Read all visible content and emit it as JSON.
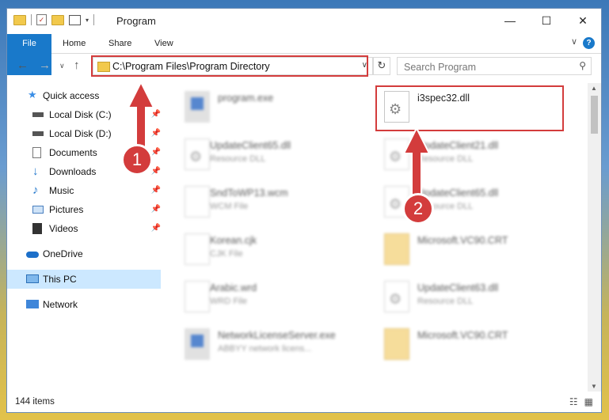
{
  "window": {
    "title": "Program",
    "controls": {
      "minimize": "—",
      "maximize": "☐",
      "close": "✕"
    }
  },
  "ribbon": {
    "tabs": [
      "File",
      "Home",
      "Share",
      "View"
    ],
    "help": "?",
    "collapse": "∨"
  },
  "nav": {
    "back": "←",
    "forward": "→",
    "recent": "∨",
    "up": "↑",
    "address": "C:\\Program Files\\Program Directory",
    "address_chevron": "∨",
    "refresh": "↻",
    "search_placeholder": "Search Program",
    "search_icon": "⚲"
  },
  "sidebar": {
    "items": [
      {
        "label": "Quick access",
        "icon": "star-icon",
        "pinned": false
      },
      {
        "label": "Local Disk (C:)",
        "icon": "drive-icon",
        "pinned": true
      },
      {
        "label": "Local Disk (D:)",
        "icon": "drive-icon",
        "pinned": true
      },
      {
        "label": "Documents",
        "icon": "documents-icon",
        "pinned": true
      },
      {
        "label": "Downloads",
        "icon": "downloads-icon",
        "pinned": true
      },
      {
        "label": "Music",
        "icon": "music-icon",
        "pinned": true
      },
      {
        "label": "Pictures",
        "icon": "pictures-icon",
        "pinned": true
      },
      {
        "label": "Videos",
        "icon": "videos-icon",
        "pinned": true
      },
      {
        "label": "OneDrive",
        "icon": "cloud-icon",
        "pinned": false
      },
      {
        "label": "This PC",
        "icon": "computer-icon",
        "pinned": false,
        "selected": true
      },
      {
        "label": "Network",
        "icon": "network-icon",
        "pinned": false
      }
    ],
    "pin_glyph": "📌"
  },
  "files": {
    "highlighted": {
      "name": "i3spec32.dll"
    },
    "items": [
      {
        "name": "program.exe",
        "desc": "",
        "icon": "exe"
      },
      {
        "name": "UpdateClient65.dll",
        "desc": "Resource DLL",
        "icon": "gear"
      },
      {
        "name": "UpdateClient21.dll",
        "desc": "Resource DLL",
        "icon": "gear"
      },
      {
        "name": "SndToWP13.wcm",
        "desc": "WCM File",
        "icon": "doc"
      },
      {
        "name": "UpdateClient65.dll",
        "desc": "Resource DLL",
        "icon": "gear"
      },
      {
        "name": "Korean.cjk",
        "desc": "CJK File",
        "icon": "doc"
      },
      {
        "name": "Microsoft.VC90.CRT",
        "desc": "",
        "icon": "yellow"
      },
      {
        "name": "Arabic.wrd",
        "desc": "WRD File",
        "icon": "doc"
      },
      {
        "name": "UpdateClient63.dll",
        "desc": "Resource DLL",
        "icon": "gear"
      },
      {
        "name": "NetworkLicenseServer.exe",
        "desc": "ABBYY network licens...",
        "icon": "exe"
      },
      {
        "name": "Microsoft.VC90.CRT",
        "desc": "",
        "icon": "yellow"
      }
    ]
  },
  "status": {
    "count": "144 items",
    "views": [
      "☷",
      "▦"
    ]
  },
  "annotations": {
    "step1": "1",
    "step2": "2",
    "accent": "#d33c3c"
  }
}
